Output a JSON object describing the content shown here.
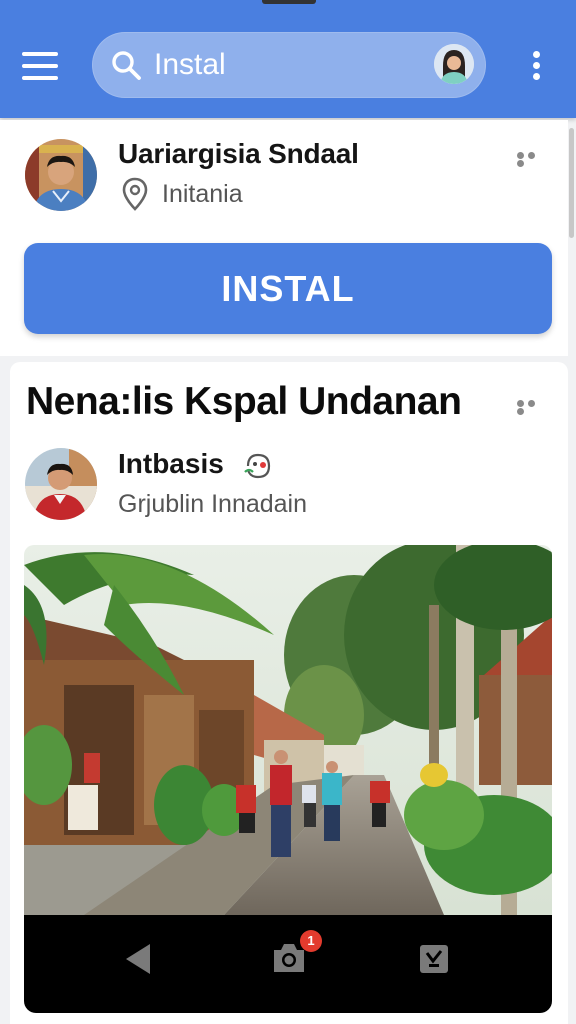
{
  "app_bar": {
    "search_value": "Instal",
    "icons": [
      "menu-icon",
      "search-icon",
      "avatar",
      "more-vert-icon"
    ],
    "color": "#4a7fe0"
  },
  "account": {
    "name": "Uariargisia Sndaal",
    "location": "Initania",
    "install_label": "INSTAL"
  },
  "post": {
    "title": "Nena:lis Kspal Undanan",
    "author": "Intbasis",
    "author_subtitle": "Grjublin Innadain",
    "notification_count": "1"
  }
}
